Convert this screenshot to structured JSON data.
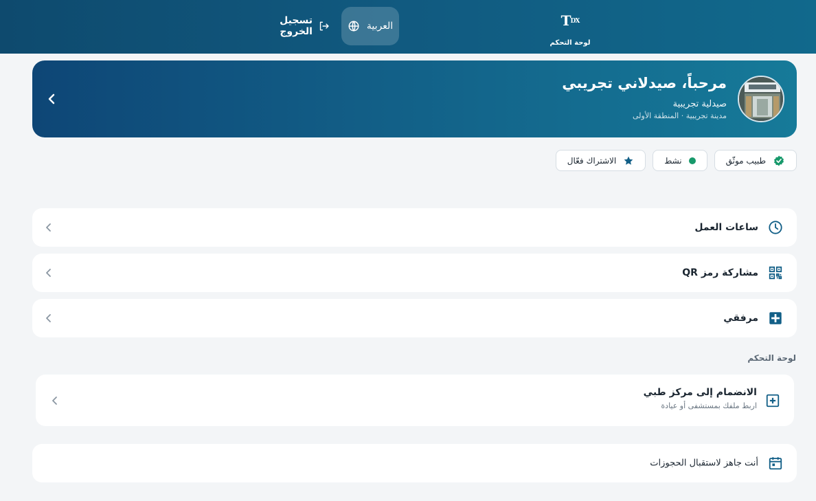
{
  "header": {
    "logo_text": "T",
    "logo_suffix": "DX",
    "dashboard_label": "لوحة التحكم",
    "language_label": "العربية",
    "logout_label": "تسجيل الخروج"
  },
  "hero": {
    "greeting": "مرحباً، صيدلاني تجريبي",
    "pharmacy_name": "صيدلية تجريبية",
    "location": "مدينة تجريبية · المنطقة الأولى"
  },
  "badges": [
    {
      "label": "طبيب موثّق",
      "icon": "verified-check-icon"
    },
    {
      "label": "نشط",
      "icon": "status-dot"
    },
    {
      "label": "الاشتراك فعّال",
      "icon": "star-icon"
    }
  ],
  "menu": [
    {
      "label": "ساعات العمل",
      "icon": "clock-icon"
    },
    {
      "label": "مشاركة رمز QR",
      "icon": "qr-code-icon"
    },
    {
      "label": "مرفقي",
      "icon": "medical-plus-icon"
    }
  ],
  "dashboard_section": {
    "title": "لوحة التحكم",
    "join_title": "الانضمام إلى مركز طبي",
    "join_subtitle": "اربط ملفك بمستشفى أو عيادة",
    "ready_label": "أنت جاهز لاستقبال الحجوزات"
  },
  "colors": {
    "primary": "#11698c",
    "accent": "#17996b",
    "icon": "#125f87"
  }
}
